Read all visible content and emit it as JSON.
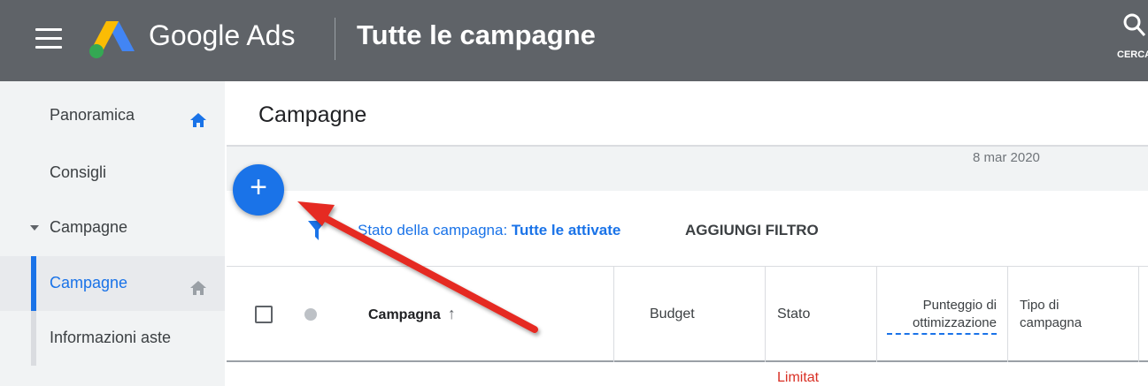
{
  "topbar": {
    "brand": "Google Ads",
    "page_name": "Tutte le campagne",
    "search_label": "CERCA"
  },
  "sidebar": {
    "items": [
      {
        "label": "Panoramica",
        "icon": "home-icon"
      },
      {
        "label": "Consigli"
      },
      {
        "label": "Campagne",
        "icon": "caret-down-icon"
      },
      {
        "label": "Campagne",
        "icon": "home-icon",
        "selected": true
      },
      {
        "label": "Informazioni aste"
      }
    ]
  },
  "main": {
    "title": "Campagne",
    "date": "8 mar 2020",
    "fab_symbol": "+",
    "filter": {
      "prefix": "Stato della campagna: ",
      "value": "Tutte le attivate",
      "add_filter": "AGGIUNGI FILTRO"
    },
    "table": {
      "columns": [
        {
          "label": "Campagna",
          "sort": "ascending"
        },
        {
          "label": "Budget"
        },
        {
          "label": "Stato"
        },
        {
          "label_line1": "Punteggio di",
          "label_line2": "ottimizzazione"
        },
        {
          "label_line1": "Tipo di",
          "label_line2": "campagna"
        }
      ],
      "rows": [
        {
          "status": "Limitat"
        }
      ]
    }
  },
  "colors": {
    "topbar": "#5f6368",
    "accent": "#1a73e8",
    "arrow": "#e52b21",
    "status_limited": "#d93025"
  }
}
